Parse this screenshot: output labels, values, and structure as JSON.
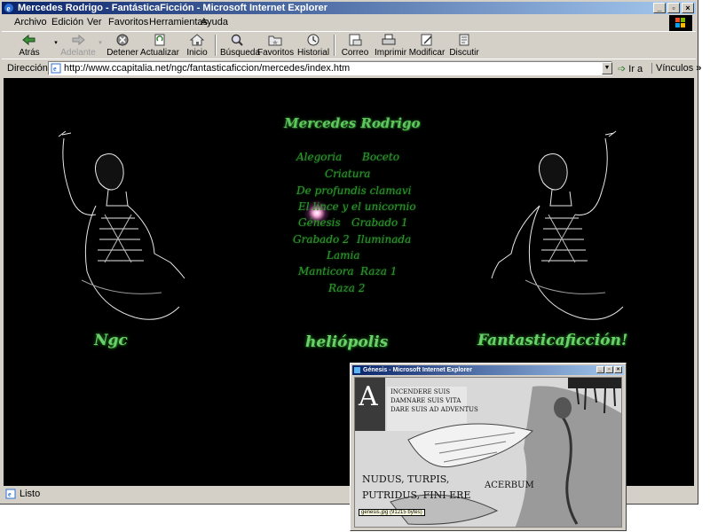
{
  "window": {
    "title": "Mercedes Rodrigo - FantásticaFicción - Microsoft Internet Explorer",
    "controls": [
      "_",
      "▫",
      "×"
    ]
  },
  "menu": {
    "items": [
      "Archivo",
      "Edición",
      "Ver",
      "Favoritos",
      "Herramientas",
      "Ayuda"
    ]
  },
  "toolbar": {
    "back": "Atrás",
    "forward": "Adelante",
    "stop": "Detener",
    "refresh": "Actualizar",
    "home": "Inicio",
    "search": "Búsqueda",
    "favorites": "Favoritos",
    "history": "Historial",
    "mail": "Correo",
    "print": "Imprimir",
    "edit": "Modificar",
    "discuss": "Discutir"
  },
  "address": {
    "label": "Dirección",
    "url": "http://www.ccapitalia.net/ngc/fantasticaficcion/mercedes/index.htm",
    "go": "Ir a",
    "links": "Vínculos"
  },
  "page": {
    "heading": "Mercedes Rodrigo",
    "links": [
      "Alegoria",
      "Boceto",
      "Criatura",
      "De profundis clamavi",
      "El lince y el unicornio",
      "Génesis",
      "Grabado 1",
      "Grabado 2",
      "Iluminada",
      "Lamia",
      "Manticora",
      "Raza 1",
      "Raza 2"
    ],
    "footer_left": "Ngc",
    "footer_center": "heliópolis",
    "footer_right": "Fantasticaficción!"
  },
  "popup": {
    "title": "Génesis - Microsoft Internet Explorer",
    "tooltip": "genesis.jpg (91215 bytes)",
    "image_text": {
      "initial": "A",
      "lines": [
        "INCENDERE SUIS",
        "DAMNARE SUIS VITA",
        "DARE SUIS AD ADVENTUS"
      ],
      "bottom1": "NUDUS, TURPIS,",
      "bottom2": "PUTRIDUS, FINI ERE",
      "acerbum": "ACERBUM"
    }
  },
  "status": {
    "text": "Listo"
  }
}
